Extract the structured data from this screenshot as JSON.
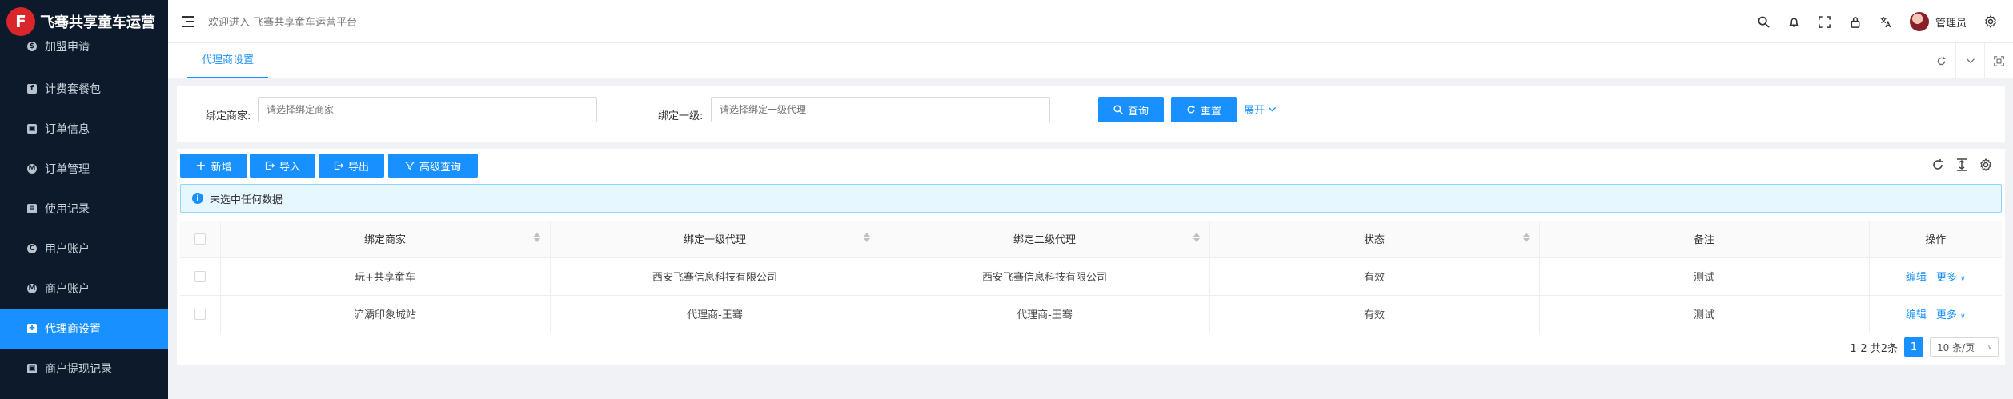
{
  "app": {
    "title": "飞骞共享童车运营",
    "logo_letter": "F"
  },
  "sidebar": {
    "items": [
      {
        "label": "加盟申请",
        "icon": "$"
      },
      {
        "label": "计费套餐包",
        "icon": "f"
      },
      {
        "label": "订单信息",
        "icon": "▣"
      },
      {
        "label": "订单管理",
        "icon": "M"
      },
      {
        "label": "使用记录",
        "icon": "≡"
      },
      {
        "label": "用户账户",
        "icon": "C"
      },
      {
        "label": "商户账户",
        "icon": "M"
      },
      {
        "label": "代理商设置",
        "icon": "✚"
      },
      {
        "label": "商户提现记录",
        "icon": "▣"
      }
    ],
    "active_index": 7
  },
  "header": {
    "welcome": "欢迎进入 飞骞共享童车运营平台",
    "user": "管理员"
  },
  "tabs": {
    "active": "代理商设置"
  },
  "search": {
    "merchant_label": "绑定商家:",
    "merchant_placeholder": "请选择绑定商家",
    "level1_label": "绑定一级:",
    "level1_placeholder": "请选择绑定一级代理",
    "query_label": "查询",
    "reset_label": "重置",
    "expand_label": "展开"
  },
  "toolbar": {
    "add_label": "新增",
    "import_label": "导入",
    "export_label": "导出",
    "advanced_label": "高级查询"
  },
  "alert": {
    "text": "未选中任何数据"
  },
  "table": {
    "columns": [
      "绑定商家",
      "绑定一级代理",
      "绑定二级代理",
      "状态",
      "备注",
      "操作"
    ],
    "rows": [
      {
        "merchant": "玩+共享童车",
        "level1": "西安飞骞信息科技有限公司",
        "level2": "西安飞骞信息科技有限公司",
        "status": "有效",
        "remark": "测试",
        "edit": "编辑",
        "more": "更多"
      },
      {
        "merchant": "浐灞印象城站",
        "level1": "代理商-王骞",
        "level2": "代理商-王骞",
        "status": "有效",
        "remark": "测试",
        "edit": "编辑",
        "more": "更多"
      }
    ]
  },
  "pagination": {
    "summary": "1-2 共2条",
    "current": "1",
    "page_size": "10 条/页"
  },
  "colors": {
    "primary": "#1890ff",
    "sidebar_bg": "#0c1a2b"
  }
}
